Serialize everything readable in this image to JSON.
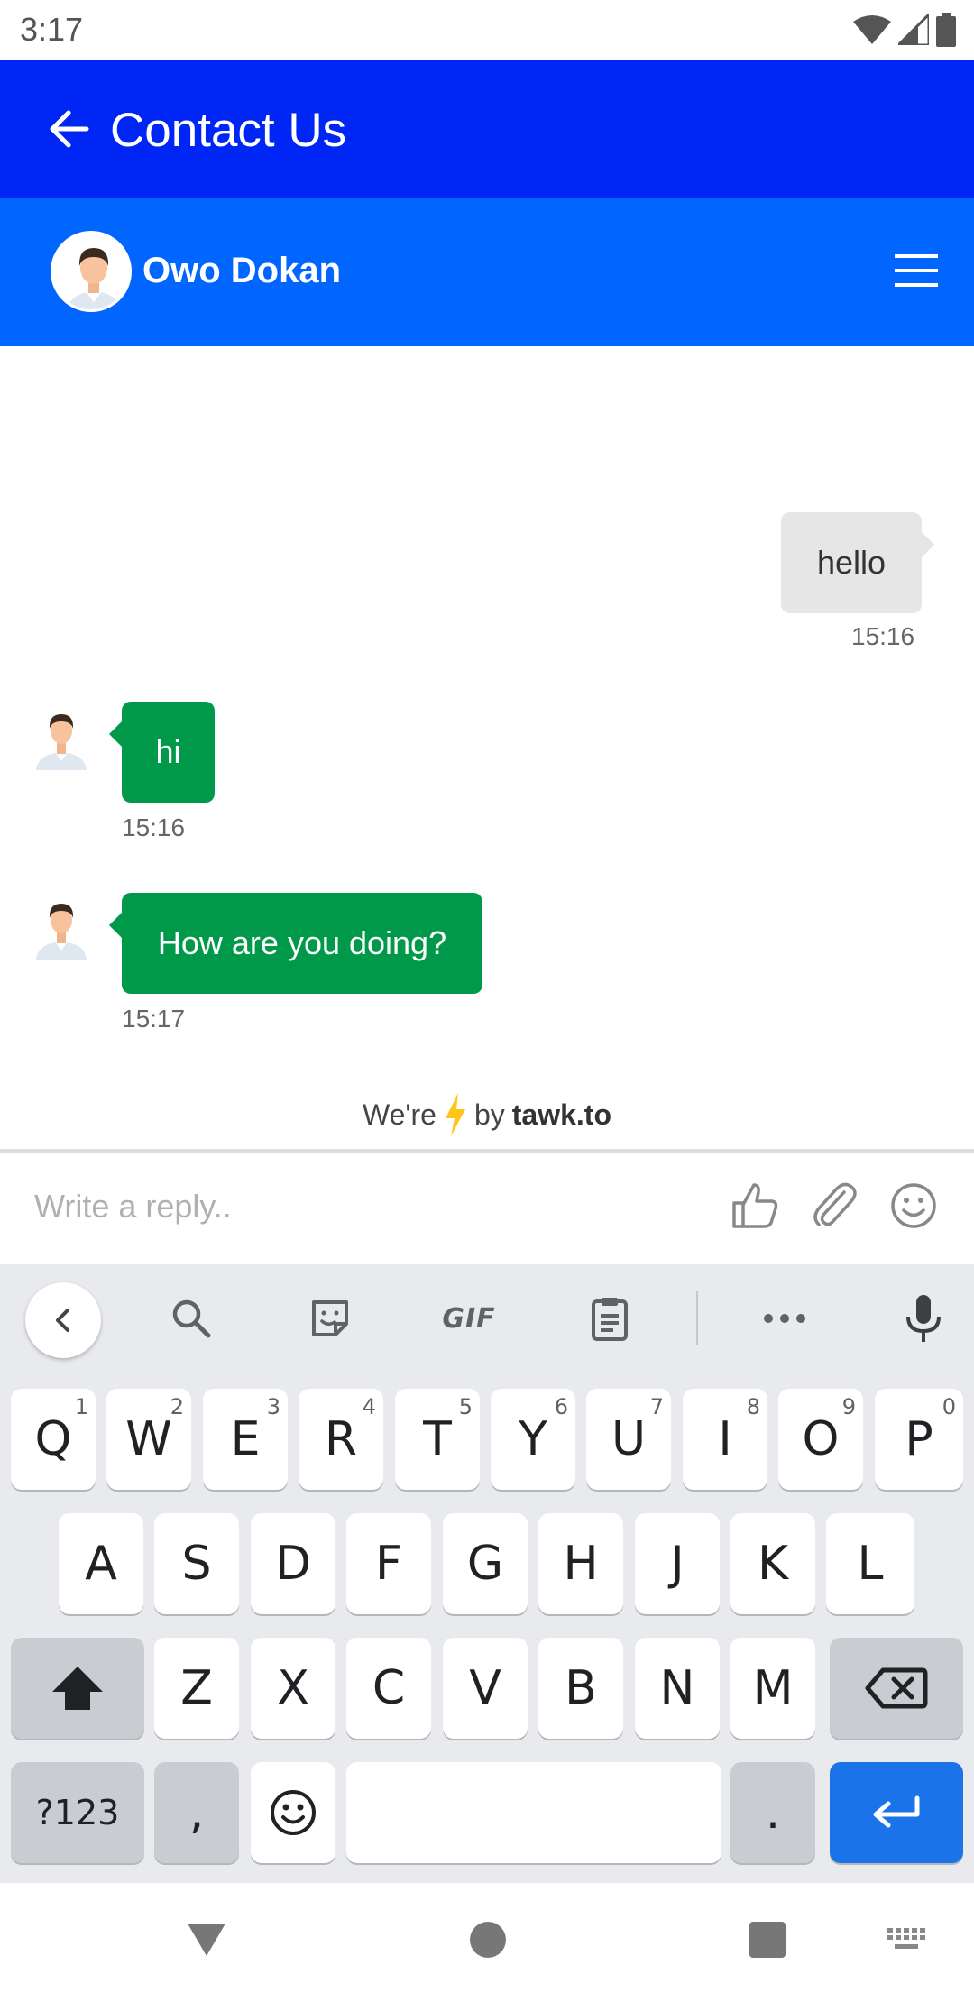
{
  "status_bar": {
    "time": "3:17"
  },
  "app_bar": {
    "title": "Contact Us"
  },
  "chat_header": {
    "agent_name": "Owo Dokan"
  },
  "messages": [
    {
      "direction": "outgoing",
      "text": "hello",
      "time": "15:16"
    },
    {
      "direction": "incoming",
      "text": "hi",
      "time": "15:16"
    },
    {
      "direction": "incoming",
      "text": "How are you doing?",
      "time": "15:17"
    }
  ],
  "powered_by": {
    "prefix": "We're",
    "by": "by",
    "brand": "tawk.to"
  },
  "reply": {
    "placeholder": "Write a reply.."
  },
  "keyboard": {
    "toolbar": {
      "gif_label": "GIF"
    },
    "row1": [
      {
        "key": "Q",
        "hint": "1"
      },
      {
        "key": "W",
        "hint": "2"
      },
      {
        "key": "E",
        "hint": "3"
      },
      {
        "key": "R",
        "hint": "4"
      },
      {
        "key": "T",
        "hint": "5"
      },
      {
        "key": "Y",
        "hint": "6"
      },
      {
        "key": "U",
        "hint": "7"
      },
      {
        "key": "I",
        "hint": "8"
      },
      {
        "key": "O",
        "hint": "9"
      },
      {
        "key": "P",
        "hint": "0"
      }
    ],
    "row2": [
      "A",
      "S",
      "D",
      "F",
      "G",
      "H",
      "J",
      "K",
      "L"
    ],
    "row3": [
      "Z",
      "X",
      "C",
      "V",
      "B",
      "N",
      "M"
    ],
    "symbols_label": "?123",
    "comma_label": ",",
    "period_label": "."
  },
  "colors": {
    "app_bar": "#0026f5",
    "chat_header": "#0066ff",
    "incoming_bubble": "#00994a",
    "outgoing_bubble": "#e6e6e6",
    "enter_key": "#1a73e8",
    "bolt": "#ffc61a"
  }
}
